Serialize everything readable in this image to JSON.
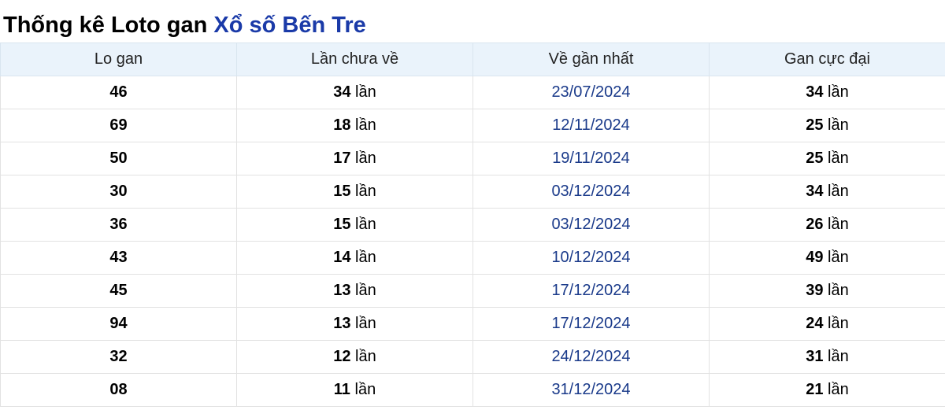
{
  "title": {
    "prefix": "Thống kê Loto gan",
    "link": "Xổ số Bến Tre"
  },
  "table": {
    "headers": [
      "Lo gan",
      "Lần chưa về",
      "Về gần nhất",
      "Gan cực đại"
    ],
    "unit": "lần",
    "rows": [
      {
        "lo": "46",
        "missed": "34",
        "last": "23/07/2024",
        "max": "34"
      },
      {
        "lo": "69",
        "missed": "18",
        "last": "12/11/2024",
        "max": "25"
      },
      {
        "lo": "50",
        "missed": "17",
        "last": "19/11/2024",
        "max": "25"
      },
      {
        "lo": "30",
        "missed": "15",
        "last": "03/12/2024",
        "max": "34"
      },
      {
        "lo": "36",
        "missed": "15",
        "last": "03/12/2024",
        "max": "26"
      },
      {
        "lo": "43",
        "missed": "14",
        "last": "10/12/2024",
        "max": "49"
      },
      {
        "lo": "45",
        "missed": "13",
        "last": "17/12/2024",
        "max": "39"
      },
      {
        "lo": "94",
        "missed": "13",
        "last": "17/12/2024",
        "max": "24"
      },
      {
        "lo": "32",
        "missed": "12",
        "last": "24/12/2024",
        "max": "31"
      },
      {
        "lo": "08",
        "missed": "11",
        "last": "31/12/2024",
        "max": "21"
      }
    ]
  },
  "colors": {
    "link": "#1a3aa8",
    "date": "#1a3a8a",
    "header_bg": "#eaf3fb"
  }
}
